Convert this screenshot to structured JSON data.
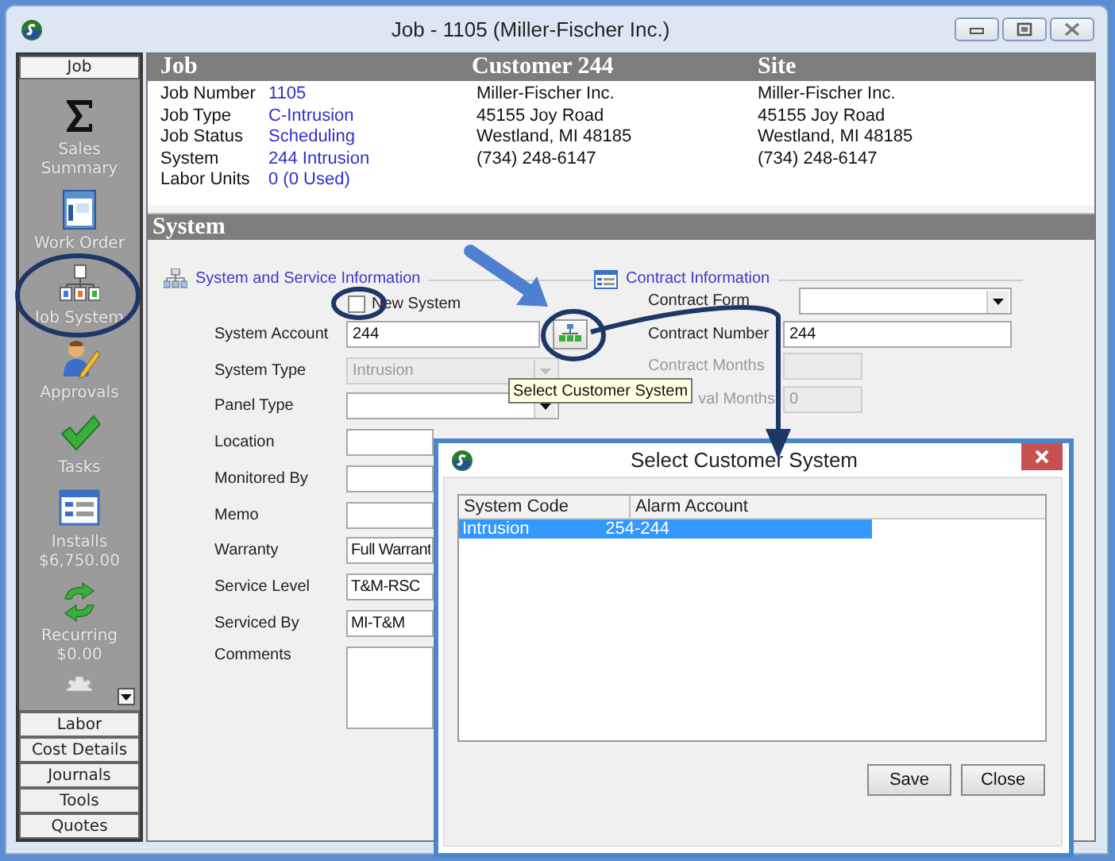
{
  "window": {
    "title": "Job - 1105 (Miller-Fischer Inc.)"
  },
  "sidebar": {
    "top_button": "Job",
    "items": [
      {
        "label": "Sales Summary"
      },
      {
        "label": "Work Order"
      },
      {
        "label": "Job System"
      },
      {
        "label": "Approvals"
      },
      {
        "label": "Tasks"
      },
      {
        "label": "Installs",
        "sublabel": "$6,750.00"
      },
      {
        "label": "Recurring",
        "sublabel": "$0.00"
      }
    ],
    "bottom_buttons": [
      "Labor",
      "Cost Details",
      "Journals",
      "Tools",
      "Quotes"
    ]
  },
  "header": {
    "job": {
      "heading": "Job",
      "fields": [
        {
          "label": "Job Number",
          "value": "1105"
        },
        {
          "label": "Job Type",
          "value": "C-Intrusion"
        },
        {
          "label": "Job Status",
          "value": "Scheduling"
        },
        {
          "label": "System",
          "value": "244 Intrusion"
        },
        {
          "label": "Labor Units",
          "value": "0 (0 Used)"
        }
      ]
    },
    "customer": {
      "heading": "Customer 244",
      "lines": [
        "Miller-Fischer Inc.",
        "45155 Joy Road",
        "Westland, MI  48185",
        "(734) 248-6147"
      ]
    },
    "site": {
      "heading": "Site",
      "lines": [
        "Miller-Fischer Inc.",
        "45155 Joy Road",
        "Westland, MI  48185",
        "(734) 248-6147"
      ]
    }
  },
  "system": {
    "heading": "System",
    "service_group": {
      "title": "System and Service Information",
      "new_system": {
        "label": "New System",
        "checked": false
      },
      "fields": [
        {
          "label": "System Account",
          "value": "244",
          "kind": "lookup",
          "disabled": false
        },
        {
          "label": "System Type",
          "value": "Intrusion",
          "kind": "dropdown",
          "disabled": true
        },
        {
          "label": "Panel Type",
          "kind": "dropdown",
          "disabled": false
        },
        {
          "label": "Location",
          "kind": "text",
          "disabled": false
        },
        {
          "label": "Monitored By",
          "kind": "text",
          "disabled": false
        },
        {
          "label": "Memo",
          "kind": "text",
          "disabled": false
        },
        {
          "label": "Warranty",
          "value": "Full Warrant",
          "kind": "text",
          "disabled": false
        },
        {
          "label": "Service Level",
          "value": "T&M-RSC",
          "kind": "text",
          "disabled": false
        },
        {
          "label": "Serviced By",
          "value": "MI-T&M",
          "kind": "text",
          "disabled": false
        },
        {
          "label": "Comments",
          "kind": "textarea",
          "disabled": false
        }
      ]
    },
    "contract_group": {
      "title": "Contract Information",
      "fields": [
        {
          "label": "Contract Form",
          "kind": "dropdown",
          "disabled": false
        },
        {
          "label": "Contract Number",
          "value": "244",
          "kind": "text",
          "disabled": false
        },
        {
          "label": "Contract Months",
          "kind": "short",
          "disabled": true
        },
        {
          "label": "val Months",
          "value": "0",
          "kind": "short",
          "disabled": true
        }
      ]
    }
  },
  "tooltip": "Select Customer System",
  "dialog": {
    "title": "Select Customer System",
    "columns": [
      "System Code",
      "Alarm Account"
    ],
    "rows": [
      {
        "cells": [
          "Intrusion",
          "254-244"
        ],
        "selected": true
      }
    ],
    "buttons": [
      "Save",
      "Close"
    ]
  }
}
